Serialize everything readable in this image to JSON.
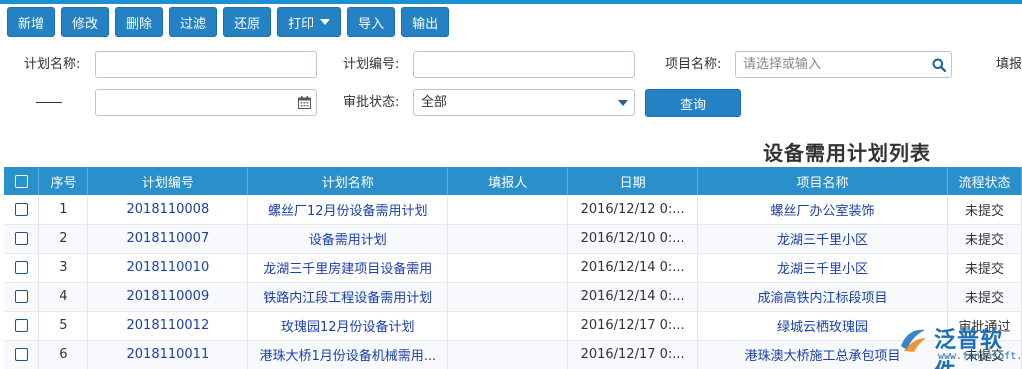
{
  "toolbar": {
    "buttons": [
      "新增",
      "修改",
      "删除",
      "过滤",
      "还原",
      "打印",
      "导入",
      "输出"
    ]
  },
  "filters": {
    "plan_name_label": "计划名称:",
    "plan_no_label": "计划编号:",
    "project_label": "项目名称:",
    "project_placeholder": "请选择或输入",
    "reporter_label": "填报",
    "status_label": "审批状态:",
    "status_value": "全部",
    "query_button": "查询"
  },
  "list_title": "设备需用计划列表",
  "table": {
    "headers": [
      "序号",
      "计划编号",
      "计划名称",
      "填报人",
      "日期",
      "项目名称",
      "流程状态"
    ],
    "rows": [
      {
        "idx": "1",
        "code": "2018110008",
        "name": "螺丝厂12月份设备需用计划",
        "reporter": "",
        "date": "2016/12/12 0:...",
        "project": "螺丝厂办公室装饰",
        "status": "未提交"
      },
      {
        "idx": "2",
        "code": "2018110007",
        "name": "设备需用计划",
        "reporter": "",
        "date": "2016/12/10 0:...",
        "project": "龙湖三千里小区",
        "status": "未提交"
      },
      {
        "idx": "3",
        "code": "2018110010",
        "name": "龙湖三千里房建项目设备需用",
        "reporter": "",
        "date": "2016/12/14 0:...",
        "project": "龙湖三千里小区",
        "status": "未提交"
      },
      {
        "idx": "4",
        "code": "2018110009",
        "name": "铁路内江段工程设备需用计划",
        "reporter": "",
        "date": "2016/12/14 0:...",
        "project": "成渝高铁内江标段项目",
        "status": "未提交"
      },
      {
        "idx": "5",
        "code": "2018110012",
        "name": "玫瑰园12月份设备计划",
        "reporter": "",
        "date": "2016/12/17 0:...",
        "project": "绿城云栖玫瑰园",
        "status": "审批通过"
      },
      {
        "idx": "6",
        "code": "2018110011",
        "name": "港珠大桥1月份设备机械需用...",
        "reporter": "",
        "date": "2016/12/17 0:...",
        "project": "港珠澳大桥施工总承包项目",
        "status": "未提交"
      }
    ]
  },
  "watermark": {
    "brand": "泛普软件",
    "url": "www.fanpusoft.com"
  },
  "colors": {
    "accent": "#2481c4",
    "header_bg": "#2a90cb",
    "link": "#1a3fb0"
  }
}
